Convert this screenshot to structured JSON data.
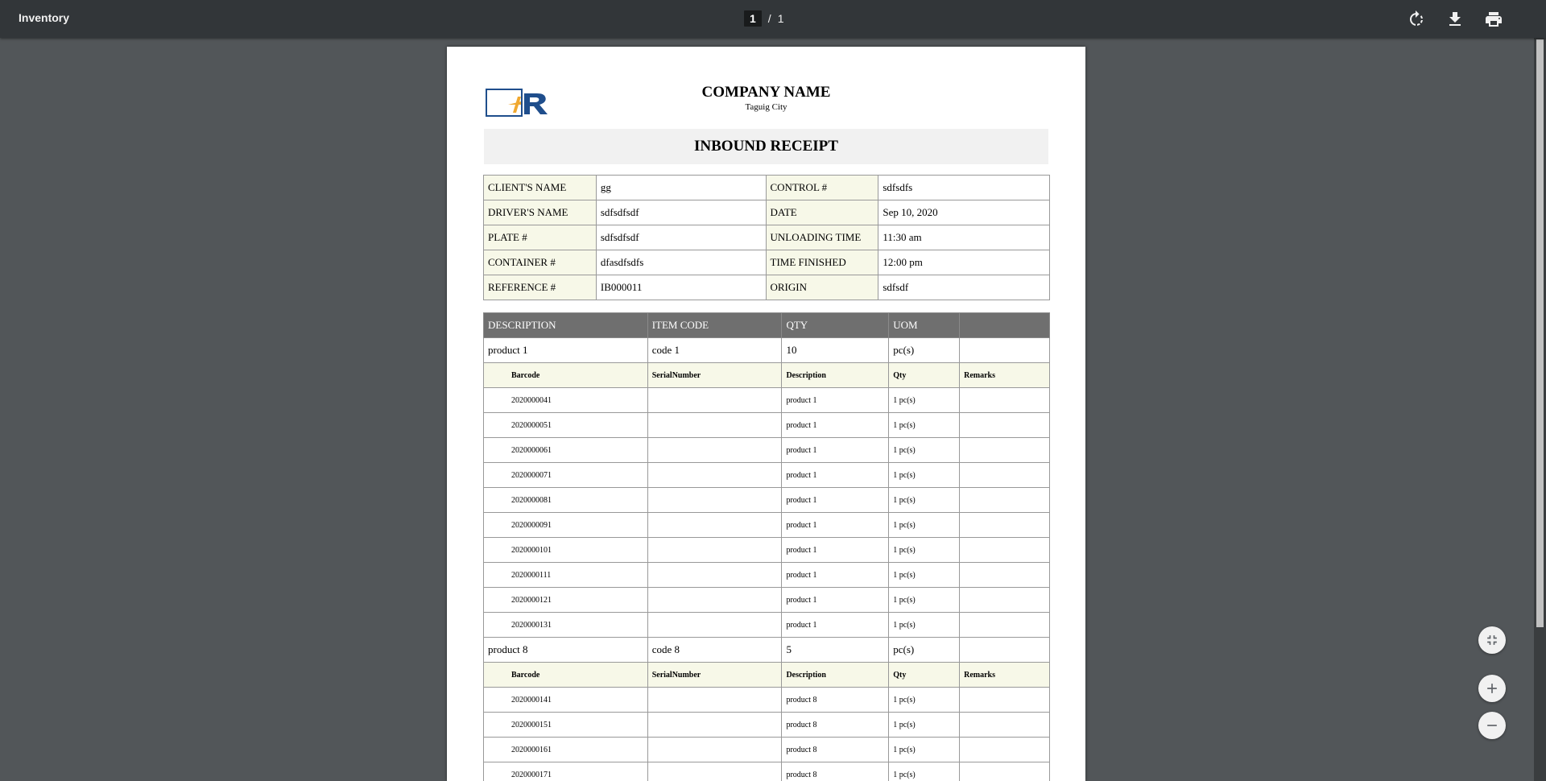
{
  "toolbar": {
    "title": "Inventory",
    "current_page": "1",
    "separator": "/",
    "total_pages": "1"
  },
  "document": {
    "company_name": "COMPANY NAME",
    "city": "Taguig City",
    "title": "INBOUND RECEIPT",
    "info_rows": [
      {
        "label1": "CLIENT'S NAME",
        "value1": "gg",
        "label2": "CONTROL #",
        "value2": "sdfsdfs"
      },
      {
        "label1": "DRIVER'S NAME",
        "value1": "sdfsdfsdf",
        "label2": "DATE",
        "value2": "Sep 10, 2020"
      },
      {
        "label1": "PLATE #",
        "value1": "sdfsdfsdf",
        "label2": "UNLOADING TIME",
        "value2": "11:30 am"
      },
      {
        "label1": "CONTAINER #",
        "value1": "dfasdfsdfs",
        "label2": "TIME FINISHED",
        "value2": "12:00 pm"
      },
      {
        "label1": "REFERENCE #",
        "value1": "IB000011",
        "label2": "ORIGIN",
        "value2": "sdfsdf"
      }
    ],
    "item_headers": [
      "DESCRIPTION",
      "ITEM CODE",
      "QTY",
      "UOM",
      ""
    ],
    "sub_headers": [
      "Barcode",
      "SerialNumber",
      "Description",
      "Qty",
      "Remarks"
    ],
    "products": [
      {
        "description": "product 1",
        "code": "code 1",
        "qty": "10",
        "uom": "pc(s)",
        "details": [
          {
            "barcode": "2020000041",
            "serial": "",
            "desc": "product 1",
            "qty": "1 pc(s)",
            "remarks": ""
          },
          {
            "barcode": "2020000051",
            "serial": "",
            "desc": "product 1",
            "qty": "1 pc(s)",
            "remarks": ""
          },
          {
            "barcode": "2020000061",
            "serial": "",
            "desc": "product 1",
            "qty": "1 pc(s)",
            "remarks": ""
          },
          {
            "barcode": "2020000071",
            "serial": "",
            "desc": "product 1",
            "qty": "1 pc(s)",
            "remarks": ""
          },
          {
            "barcode": "2020000081",
            "serial": "",
            "desc": "product 1",
            "qty": "1 pc(s)",
            "remarks": ""
          },
          {
            "barcode": "2020000091",
            "serial": "",
            "desc": "product 1",
            "qty": "1 pc(s)",
            "remarks": ""
          },
          {
            "barcode": "2020000101",
            "serial": "",
            "desc": "product 1",
            "qty": "1 pc(s)",
            "remarks": ""
          },
          {
            "barcode": "2020000111",
            "serial": "",
            "desc": "product 1",
            "qty": "1 pc(s)",
            "remarks": ""
          },
          {
            "barcode": "2020000121",
            "serial": "",
            "desc": "product 1",
            "qty": "1 pc(s)",
            "remarks": ""
          },
          {
            "barcode": "2020000131",
            "serial": "",
            "desc": "product 1",
            "qty": "1 pc(s)",
            "remarks": ""
          }
        ]
      },
      {
        "description": "product 8",
        "code": "code 8",
        "qty": "5",
        "uom": "pc(s)",
        "details": [
          {
            "barcode": "2020000141",
            "serial": "",
            "desc": "product 8",
            "qty": "1 pc(s)",
            "remarks": ""
          },
          {
            "barcode": "2020000151",
            "serial": "",
            "desc": "product 8",
            "qty": "1 pc(s)",
            "remarks": ""
          },
          {
            "barcode": "2020000161",
            "serial": "",
            "desc": "product 8",
            "qty": "1 pc(s)",
            "remarks": ""
          },
          {
            "barcode": "2020000171",
            "serial": "",
            "desc": "product 8",
            "qty": "1 pc(s)",
            "remarks": ""
          }
        ]
      }
    ]
  },
  "icons": {
    "rotate": "rotate-icon",
    "download": "download-icon",
    "print": "print-icon",
    "fit": "fit-to-page-icon",
    "zoom_in": "zoom-in-icon",
    "zoom_out": "zoom-out-icon"
  },
  "colors": {
    "toolbar_bg": "#323639",
    "viewer_bg": "#525659",
    "label_bg": "#f7f8e8",
    "header_bg": "#6f6f6f",
    "logo_blue": "#1f4e8c",
    "logo_orange": "#f0a830"
  }
}
